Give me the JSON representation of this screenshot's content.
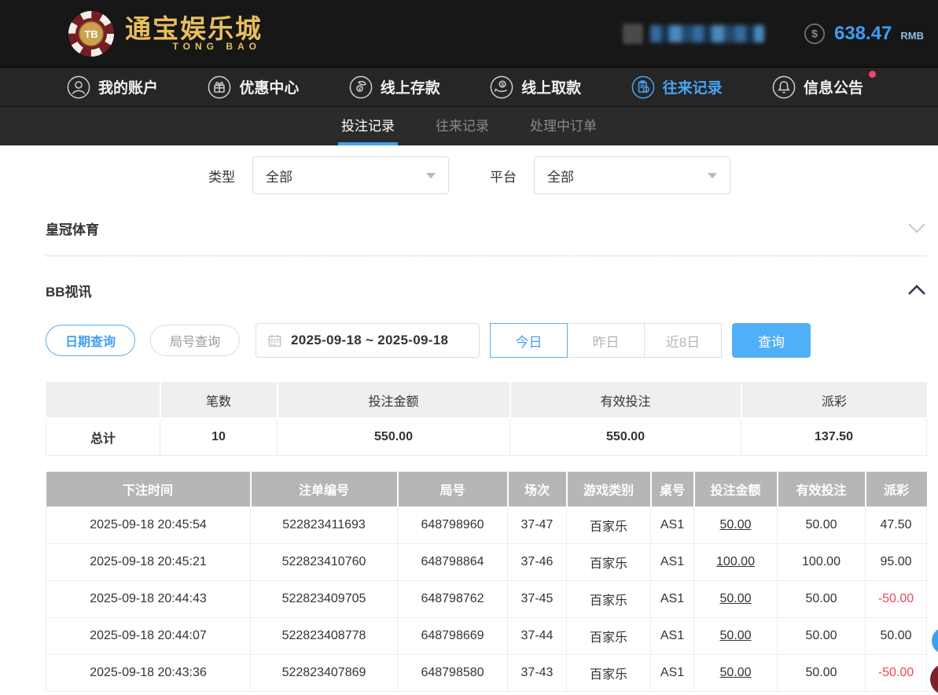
{
  "header": {
    "logo": {
      "chip_text": "TB",
      "title": "通宝娱乐城",
      "subtitle": "TONG BAO"
    },
    "balance": {
      "amount": "638.47",
      "currency": "RMB"
    }
  },
  "nav": {
    "items": [
      {
        "label": "我的账户",
        "icon": "user-icon",
        "active": false
      },
      {
        "label": "优惠中心",
        "icon": "gift-icon",
        "active": false
      },
      {
        "label": "线上存款",
        "icon": "deposit-icon",
        "active": false
      },
      {
        "label": "线上取款",
        "icon": "withdraw-icon",
        "active": false
      },
      {
        "label": "往来记录",
        "icon": "records-icon",
        "active": true
      },
      {
        "label": "信息公告",
        "icon": "bell-icon",
        "active": false,
        "has_notification_dot": true
      }
    ]
  },
  "subtabs": {
    "items": [
      {
        "label": "投注记录",
        "active": true
      },
      {
        "label": "往来记录",
        "active": false
      },
      {
        "label": "处理中订单",
        "active": false
      }
    ]
  },
  "filters": {
    "type": {
      "label": "类型",
      "value": "全部"
    },
    "platform": {
      "label": "平台",
      "value": "全部"
    }
  },
  "sections": {
    "crown_sports": {
      "title": "皇冠体育",
      "collapsed": true
    },
    "bb_video": {
      "title": "BB视讯",
      "collapsed": false
    }
  },
  "query_bar": {
    "date_query_btn": "日期查询",
    "round_query_btn": "局号查询",
    "date_range": "2025-09-18 ~ 2025-09-18",
    "quick_buttons": [
      {
        "label": "今日",
        "active": true
      },
      {
        "label": "昨日",
        "active": false
      },
      {
        "label": "近8日",
        "active": false
      }
    ],
    "search_btn": "查询"
  },
  "summary_table": {
    "headers": [
      "",
      "笔数",
      "投注金额",
      "有效投注",
      "派彩"
    ],
    "total_label": "总计",
    "count": "10",
    "bet_amount": "550.00",
    "valid_bet": "550.00",
    "payout": "137.50"
  },
  "bet_table": {
    "headers": [
      "下注时间",
      "注单编号",
      "局号",
      "场次",
      "游戏类别",
      "桌号",
      "投注金额",
      "有效投注",
      "派彩"
    ],
    "rows": [
      {
        "time": "2025-09-18 20:45:54",
        "order_id": "522823411693",
        "round_id": "648798960",
        "session": "37-47",
        "game": "百家乐",
        "table_no": "AS1",
        "bet": "50.00",
        "valid": "50.00",
        "payout": "47.50"
      },
      {
        "time": "2025-09-18 20:45:21",
        "order_id": "522823410760",
        "round_id": "648798864",
        "session": "37-46",
        "game": "百家乐",
        "table_no": "AS1",
        "bet": "100.00",
        "valid": "100.00",
        "payout": "95.00"
      },
      {
        "time": "2025-09-18 20:44:43",
        "order_id": "522823409705",
        "round_id": "648798762",
        "session": "37-45",
        "game": "百家乐",
        "table_no": "AS1",
        "bet": "50.00",
        "valid": "50.00",
        "payout": "-50.00"
      },
      {
        "time": "2025-09-18 20:44:07",
        "order_id": "522823408778",
        "round_id": "648798669",
        "session": "37-44",
        "game": "百家乐",
        "table_no": "AS1",
        "bet": "50.00",
        "valid": "50.00",
        "payout": "50.00"
      },
      {
        "time": "2025-09-18 20:43:36",
        "order_id": "522823407869",
        "round_id": "648798580",
        "session": "37-43",
        "game": "百家乐",
        "table_no": "AS1",
        "bet": "50.00",
        "valid": "50.00",
        "payout": "-50.00"
      }
    ]
  },
  "colors": {
    "accent_blue": "#47a4f3",
    "negative_red": "#f0455a",
    "header_bg": "#171717",
    "notification_red": "#f1446b"
  }
}
